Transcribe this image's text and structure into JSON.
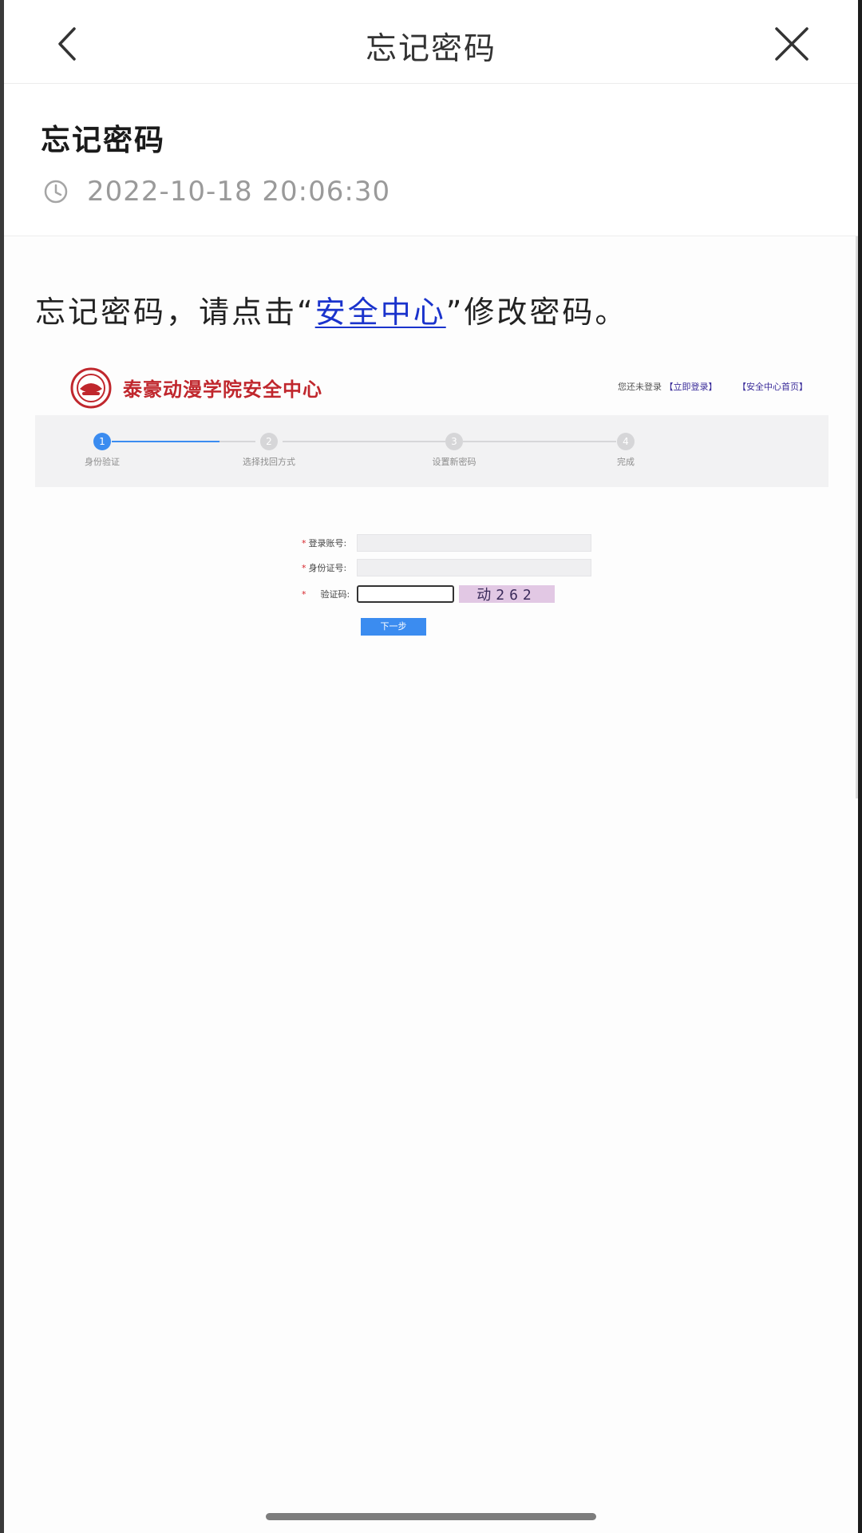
{
  "nav": {
    "title": "忘记密码",
    "back_icon": "chevron-left-icon",
    "close_icon": "close-icon"
  },
  "article": {
    "title": "忘记密码",
    "time": "2022-10-18 20:06:30",
    "time_icon": "clock-icon",
    "body_prefix": "忘记密码，请点击“",
    "link_text": "安全中心",
    "body_suffix": "”修改密码。",
    "link_color": "#1a33cc"
  },
  "screenshot": {
    "site_name": "泰豪动漫学院安全中心",
    "top_right_prefix": "您还未登录",
    "login_link": "【立即登录】",
    "home_link": "【安全中心首页】",
    "brand_color": "#c0272d",
    "accent_color": "#3b8cf0",
    "steps": [
      {
        "num": "1",
        "label": "身份验证"
      },
      {
        "num": "2",
        "label": "选择找回方式"
      },
      {
        "num": "3",
        "label": "设置新密码"
      },
      {
        "num": "4",
        "label": "完成"
      }
    ],
    "form": {
      "required_mark": "*",
      "account_label": "登录账号:",
      "id_label": "身份证号:",
      "captcha_label": "验证码:",
      "captcha_text": "动262",
      "next_button": "下一步"
    }
  }
}
